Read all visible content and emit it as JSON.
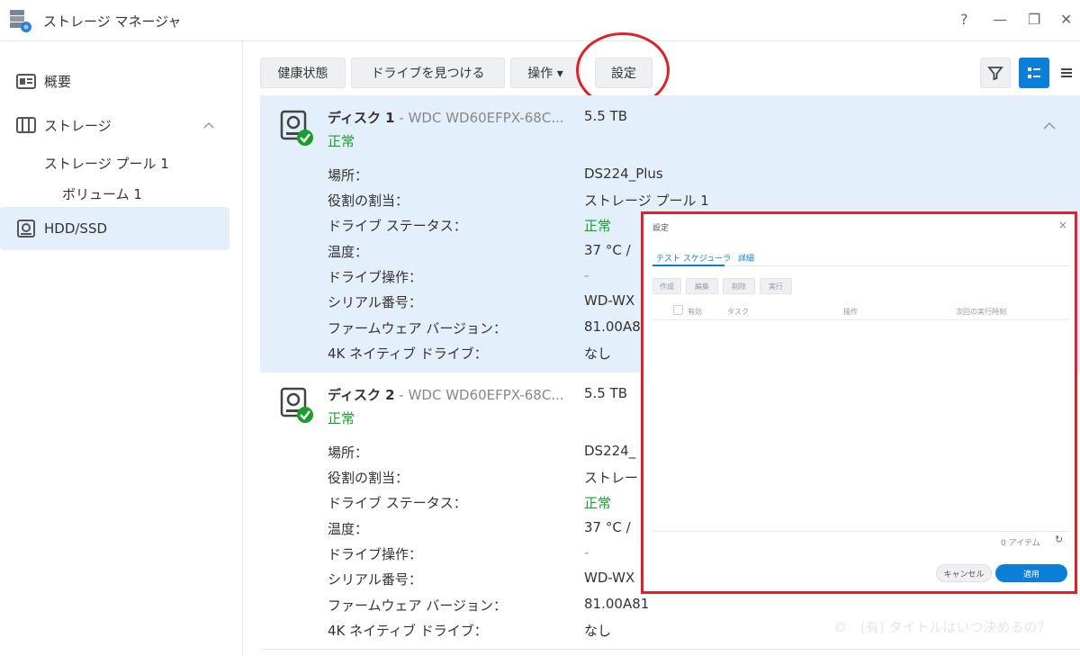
{
  "window": {
    "title": "ストレージ マネージャ",
    "controls": {
      "help": "?",
      "minimize": "—",
      "restore": "❐",
      "close": "✕"
    }
  },
  "sidebar": {
    "overview": "概要",
    "storage": "ストレージ",
    "storage_pool": "ストレージ プール 1",
    "volume": "ボリューム 1",
    "hdd": "HDD/SSD"
  },
  "toolbar": {
    "health": "健康状態",
    "find_drive": "ドライブを見つける",
    "action": "操作 ▾",
    "settings": "設定",
    "icons": [
      "filter-icon",
      "detail-view-icon",
      "list-view-icon"
    ]
  },
  "disks": [
    {
      "name": "ディスク 1",
      "model": " - WDC WD60EFPX-68C...",
      "size": "5.5 TB",
      "status": "正常",
      "labels": [
        "場所：",
        "役割の割当：",
        "ドライブ ステータス：",
        "温度：",
        "ドライブ操作：",
        "シリアル番号：",
        "ファームウェア バージョン：",
        "4K ネイティブ ドライブ："
      ],
      "values": [
        "DS224_Plus",
        "ストレージ プール 1",
        "正常",
        "37 °C /",
        "-",
        "WD-WX",
        "81.00A8",
        "なし"
      ]
    },
    {
      "name": "ディスク 2",
      "model": " - WDC WD60EFPX-68C...",
      "size": "5.5 TB",
      "status": "正常",
      "labels": [
        "場所：",
        "役割の割当：",
        "ドライブ ステータス：",
        "温度：",
        "ドライブ操作：",
        "シリアル番号：",
        "ファームウェア バージョン：",
        "4K ネイティブ ドライブ："
      ],
      "values": [
        "DS224_",
        "ストレー",
        "正常",
        "37 °C /",
        "-",
        "WD-WX",
        "81.00A81",
        "なし"
      ]
    }
  ],
  "dialog": {
    "title": "設定",
    "close": "×",
    "tabs": [
      "テスト スケジューラ",
      "詳細"
    ],
    "buttons": [
      "作成",
      "編集",
      "削除",
      "実行"
    ],
    "columns": [
      "有効",
      "タスク",
      "操作",
      "次回の実行時刻"
    ],
    "count": "0 アイテム",
    "refresh": "↻",
    "cancel": "キャンセル",
    "apply": "適用"
  },
  "watermark": "©　(有) タイトルはいつ決めるの？",
  "colors": {
    "accent": "#0b7fd8",
    "ok": "#1a9d2e",
    "highlight": "#d8242f",
    "selected_bg": "#e3effb"
  }
}
